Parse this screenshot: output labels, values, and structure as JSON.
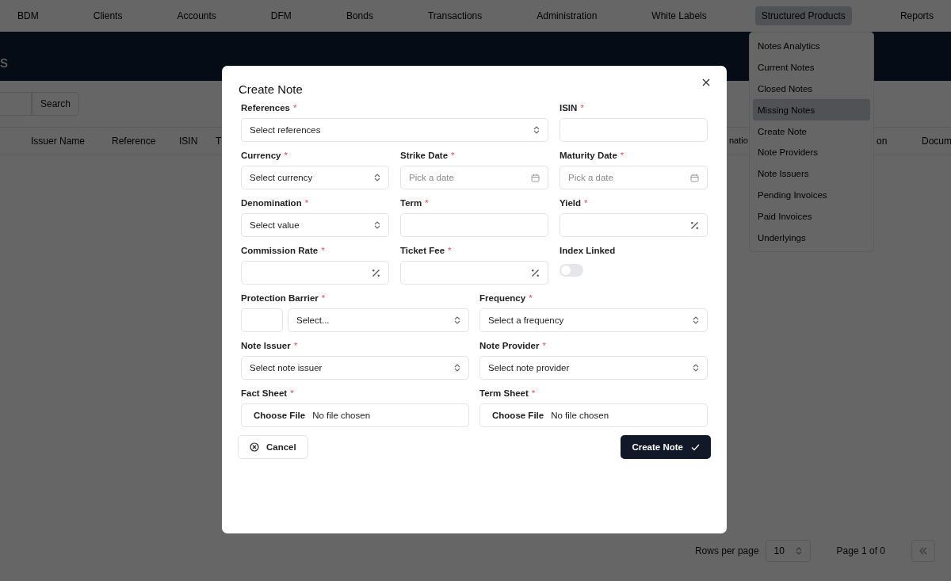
{
  "nav": [
    {
      "label": "BDM",
      "selected": false
    },
    {
      "label": "Clients",
      "selected": false
    },
    {
      "label": "Accounts",
      "selected": false
    },
    {
      "label": "DFM",
      "selected": false
    },
    {
      "label": "Bonds",
      "selected": false
    },
    {
      "label": "Transactions",
      "selected": false
    },
    {
      "label": "Administration",
      "selected": false
    },
    {
      "label": "White Labels",
      "selected": false
    },
    {
      "label": "Structured Products",
      "selected": true
    },
    {
      "label": "Reports",
      "selected": false
    }
  ],
  "menu": [
    {
      "label": "Notes Analytics",
      "selected": false
    },
    {
      "label": "Current Notes",
      "selected": false
    },
    {
      "label": "Closed Notes",
      "selected": false
    },
    {
      "label": "Missing Notes",
      "selected": true
    },
    {
      "label": "Create Note",
      "selected": false
    },
    {
      "label": "Note Providers",
      "selected": false
    },
    {
      "label": "Note Issuers",
      "selected": false
    },
    {
      "label": "Pending Invoices",
      "selected": false
    },
    {
      "label": "Paid Invoices",
      "selected": false
    },
    {
      "label": "Underlyings",
      "selected": false
    }
  ],
  "page_title": "s",
  "search_button": "Search",
  "table": {
    "columns_left": [
      "Issuer Name",
      "Reference",
      "ISIN",
      "T"
    ],
    "columns_right": [
      "natio",
      "on",
      "Docum"
    ]
  },
  "pagination": {
    "rows_label": "Rows per page",
    "rows_value": "10",
    "page_label": "Page 1 of 0"
  },
  "modal": {
    "title": "Create Note",
    "sections": [
      {
        "rows": [
          {
            "fields": [
              {
                "kind": "select",
                "label": "References",
                "marker": "*",
                "placeholder": "Select references"
              },
              {
                "kind": "text",
                "label": "ISIN",
                "marker": "*"
              }
            ]
          },
          {
            "fields": [
              {
                "kind": "select",
                "label": "Currency",
                "marker": "*",
                "placeholder": "Select currency"
              },
              {
                "kind": "date",
                "label": "Strike Date",
                "marker": "*",
                "placeholder": "Pick a date"
              },
              {
                "kind": "date",
                "label": "Maturity Date",
                "marker": "*",
                "placeholder": "Pick a date"
              }
            ]
          },
          {
            "fields": [
              {
                "kind": "select",
                "label": "Denomination",
                "marker": "*",
                "placeholder": "Select value"
              },
              {
                "kind": "text",
                "label": "Term",
                "marker": "*"
              },
              {
                "kind": "percent",
                "label": "Yield",
                "marker": "*"
              }
            ]
          },
          {
            "fields": [
              {
                "kind": "percent",
                "label": "Commission Rate",
                "marker": "*"
              },
              {
                "kind": "percent",
                "label": "Ticket Fee",
                "marker": "*"
              },
              {
                "kind": "toggle",
                "label": "Index Linked",
                "on": false
              }
            ]
          }
        ]
      },
      {
        "rows": [
          {
            "fields": [
              {
                "kind": "barrier",
                "label": "Protection Barrier",
                "marker": "*",
                "placeholder": "Select..."
              },
              {
                "kind": "select",
                "label": "Frequency",
                "marker": "*",
                "placeholder": "Select a frequency"
              }
            ]
          },
          {
            "fields": [
              {
                "kind": "select",
                "label": "Note Issuer",
                "marker": "*",
                "placeholder": "Select note issuer"
              },
              {
                "kind": "select",
                "label": "Note Provider",
                "marker": "*",
                "placeholder": "Select note provider"
              }
            ]
          },
          {
            "fields": [
              {
                "kind": "file",
                "label": "Fact Sheet",
                "marker": "*",
                "button": "Choose File",
                "status": "No file chosen"
              },
              {
                "kind": "file",
                "label": "Term Sheet",
                "marker": "*",
                "button": "Choose File",
                "status": "No file chosen"
              }
            ]
          }
        ]
      }
    ],
    "cancel": "Cancel",
    "submit": "Create Note"
  }
}
